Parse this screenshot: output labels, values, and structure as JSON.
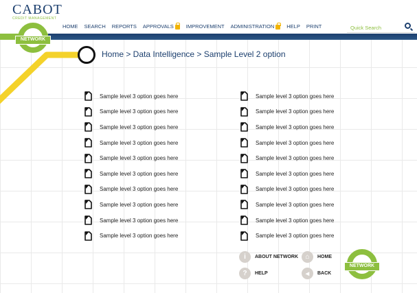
{
  "brand": {
    "name": "CABOT",
    "tagline": "CREDIT MANAGEMENT"
  },
  "nav": [
    {
      "label": "HOME",
      "locked": false
    },
    {
      "label": "SEARCH",
      "locked": false
    },
    {
      "label": "REPORTS",
      "locked": false
    },
    {
      "label": "APPROVALS",
      "locked": true
    },
    {
      "label": "IMPROVEMENT",
      "locked": false
    },
    {
      "label": "ADMINISTRATION",
      "locked": true
    },
    {
      "label": "HELP",
      "locked": false
    },
    {
      "label": "PRINT",
      "locked": false
    }
  ],
  "search": {
    "placeholder": "Quick Search",
    "icon": "magnifier-icon"
  },
  "network_label": "NETWORK",
  "breadcrumb": "Home > Data Intelligence > Sample Level 2 option",
  "left_column": [
    "Sample level 3 option goes here",
    "Sample level 3 option goes here",
    "Sample level 3 option goes here",
    "Sample level 3 option goes here",
    "Sample level 3 option goes here",
    "Sample level 3 option goes here",
    "Sample level 3 option goes here",
    "Sample level 3 option goes here",
    "Sample level 3 option goes here",
    "Sample level 3 option goes here"
  ],
  "right_column": [
    "Sample level 3 option goes here",
    "Sample level 3 option goes here",
    "Sample level 3 option goes here",
    "Sample level 3 option goes here",
    "Sample level 3 option goes here",
    "Sample level 3 option goes here",
    "Sample level 3 option goes here",
    "Sample level 3 option goes here",
    "Sample level 3 option goes here",
    "Sample level 3 option goes here"
  ],
  "footer": {
    "about": {
      "label": "ABOUT NETWORK",
      "icon_glyph": "i"
    },
    "help": {
      "label": "HELP",
      "icon_glyph": "?"
    },
    "home": {
      "label": "HOME",
      "icon_glyph": "⌂"
    },
    "back": {
      "label": "BACK",
      "icon_glyph": "◀"
    }
  },
  "colors": {
    "brand_navy": "#1c3f6e",
    "brand_green": "#8dbf3f",
    "line_yellow": "#f4d22a",
    "lock_gold": "#f2b400"
  }
}
